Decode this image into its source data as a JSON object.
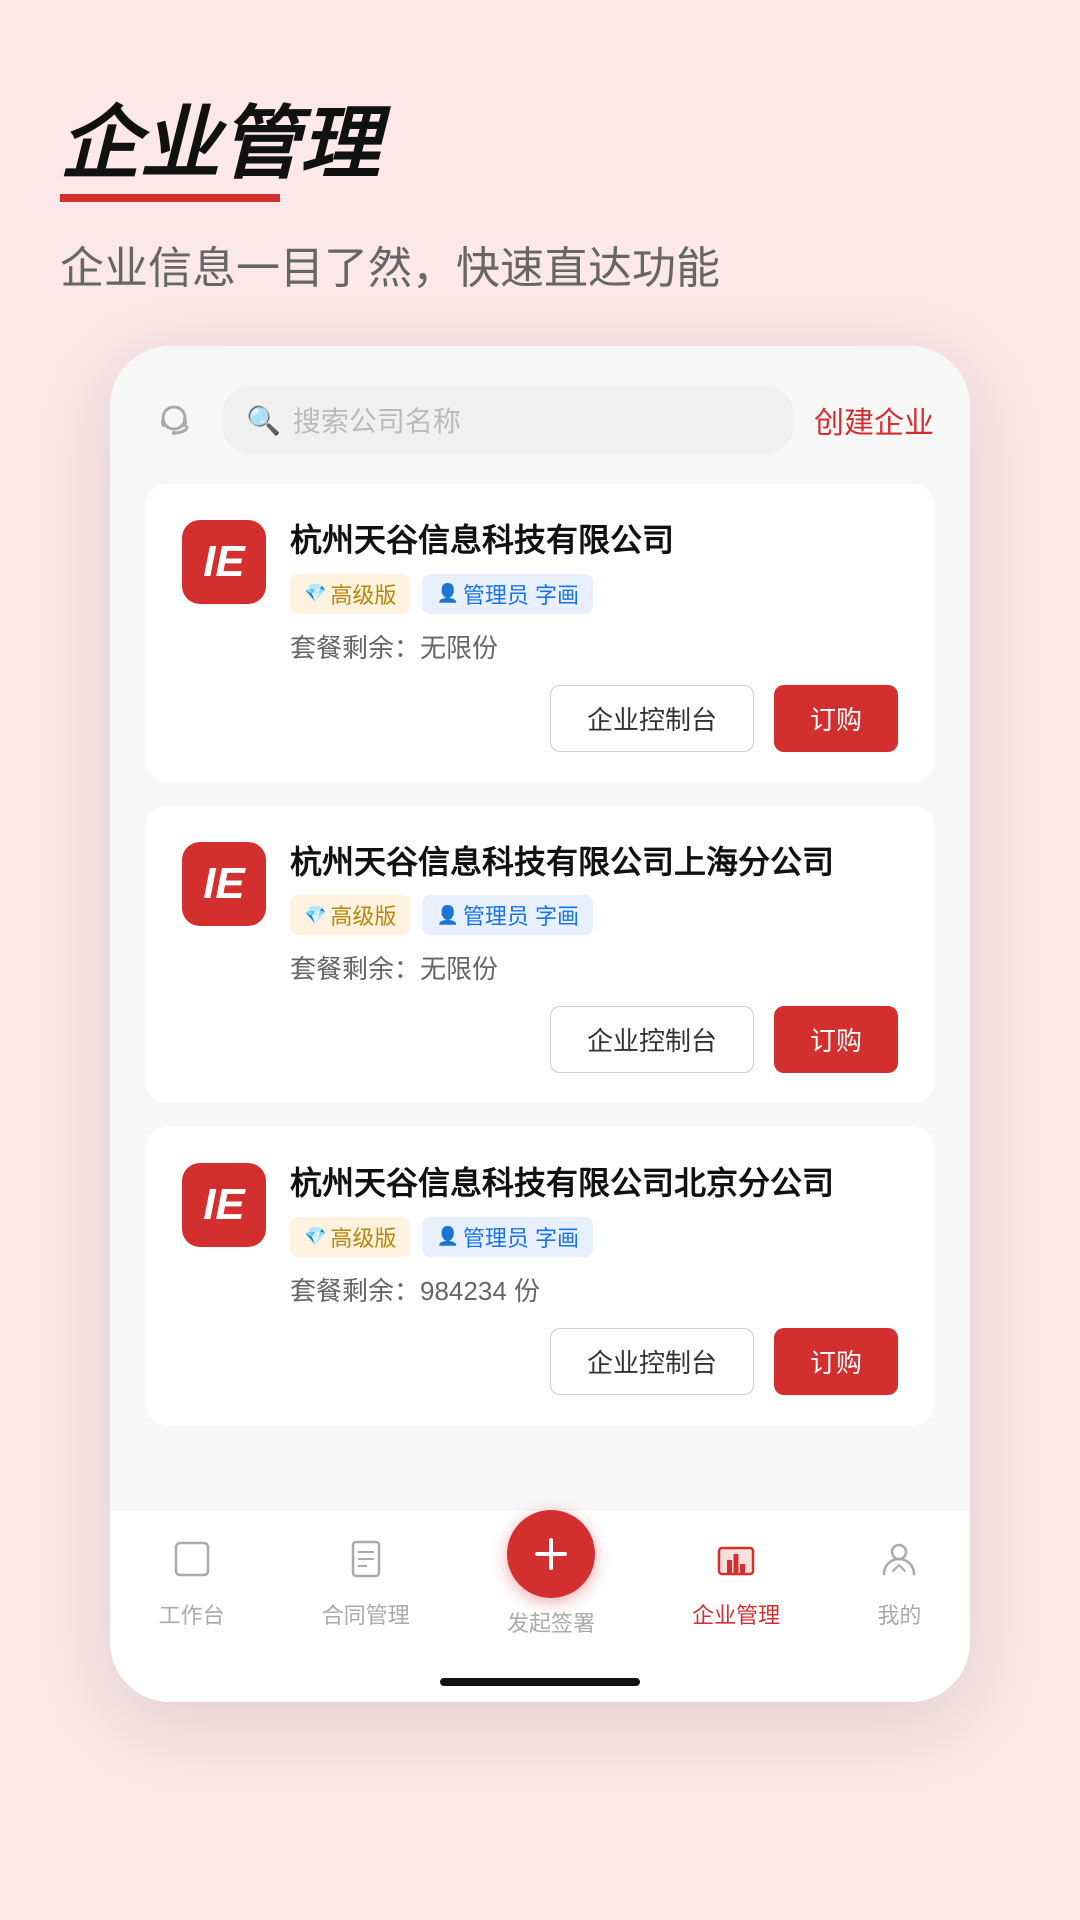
{
  "header": {
    "title": "企业管理",
    "subtitle": "企业信息一目了然，快速直达功能"
  },
  "search": {
    "placeholder": "搜索公司名称",
    "create_label": "创建企业"
  },
  "companies": [
    {
      "id": 1,
      "logo": "IE",
      "name": "杭州天谷信息科技有限公司",
      "vip_tag": "高级版",
      "admin_tag": "管理员 字画",
      "quota_label": "套餐剩余：",
      "quota_value": "无限份",
      "console_btn": "企业控制台",
      "order_btn": "订购"
    },
    {
      "id": 2,
      "logo": "IE",
      "name": "杭州天谷信息科技有限公司上海分公司",
      "vip_tag": "高级版",
      "admin_tag": "管理员 字画",
      "quota_label": "套餐剩余：",
      "quota_value": "无限份",
      "console_btn": "企业控制台",
      "order_btn": "订购"
    },
    {
      "id": 3,
      "logo": "IE",
      "name": "杭州天谷信息科技有限公司北京分公司",
      "vip_tag": "高级版",
      "admin_tag": "管理员 字画",
      "quota_label": "套餐剩余：",
      "quota_value": "984234 份",
      "console_btn": "企业控制台",
      "order_btn": "订购"
    }
  ],
  "tabs": [
    {
      "id": "workbench",
      "label": "工作台",
      "active": false
    },
    {
      "id": "contract",
      "label": "合同管理",
      "active": false
    },
    {
      "id": "sign",
      "label": "发起签署",
      "active": false,
      "is_fab": true
    },
    {
      "id": "enterprise",
      "label": "企业管理",
      "active": true
    },
    {
      "id": "mine",
      "label": "我的",
      "active": false
    }
  ]
}
